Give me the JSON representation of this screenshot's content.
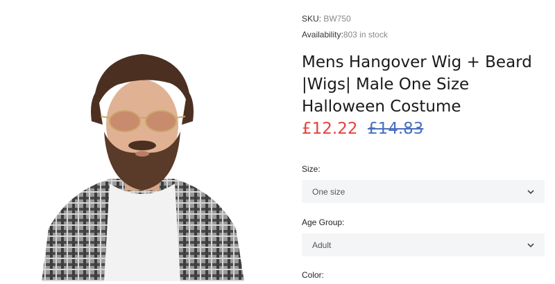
{
  "product": {
    "sku_label": "SKU:",
    "sku_value": "BW750",
    "availability_label": "Availability:",
    "availability_value": "803 in stock",
    "title": "Mens Hangover Wig + Beard |Wigs| Male One Size Halloween Costume",
    "price_current": "£12.22",
    "price_old": "£14.83"
  },
  "options": {
    "size": {
      "label": "Size:",
      "selected": "One size"
    },
    "age_group": {
      "label": "Age Group:",
      "selected": "Adult"
    },
    "color": {
      "label": "Color:"
    }
  },
  "icons": {
    "size_chevron": "chevron-down-icon",
    "age_chevron": "chevron-down-icon"
  },
  "colors": {
    "price_current": "#e8413c",
    "price_old": "#4a6fc0",
    "select_bg": "#f4f5f7"
  }
}
